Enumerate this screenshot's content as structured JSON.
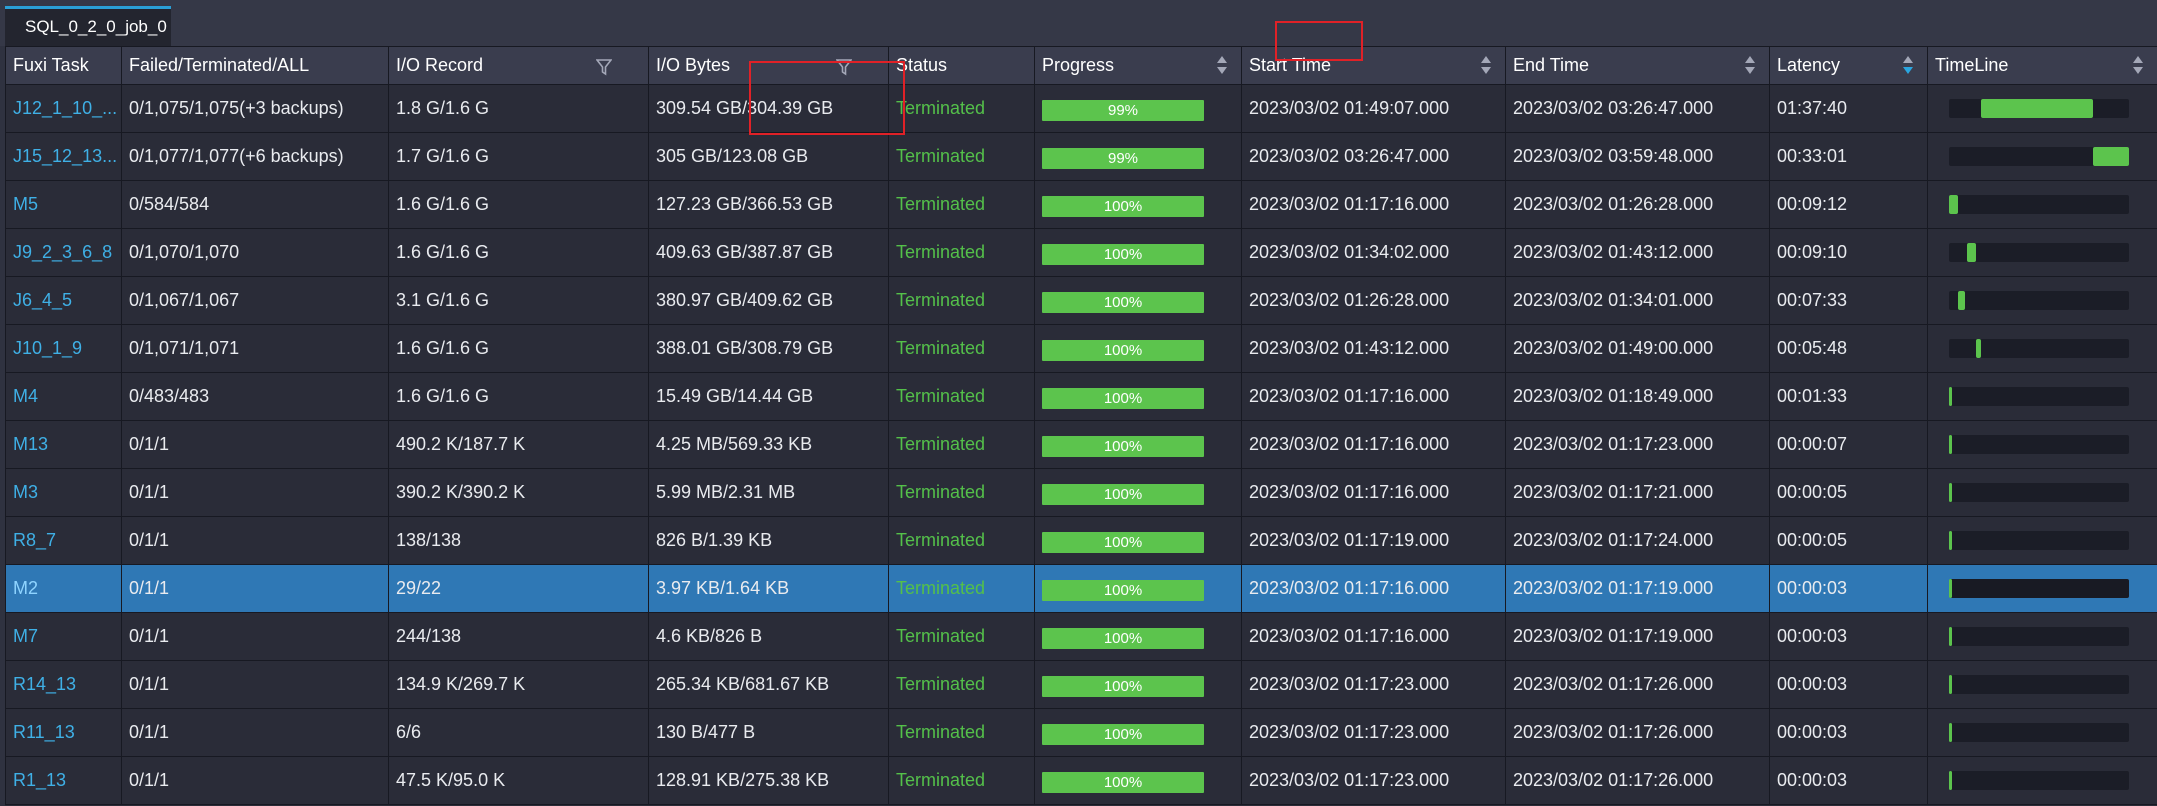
{
  "tab": {
    "label": "SQL_0_2_0_job_0"
  },
  "columns": {
    "task": "Fuxi Task",
    "instances": "Failed/Terminated/ALL",
    "io_record": "I/O Record",
    "io_bytes": "I/O Bytes",
    "status": "Status",
    "progress": "Progress",
    "start_time": "Start Time",
    "end_time": "End Time",
    "latency": "Latency",
    "timeline": "TimeLine"
  },
  "colors": {
    "accent": "#2a9fd6",
    "task_link": "#3fb0e6",
    "status_terminated": "#54c04a",
    "progress_fill": "#5cc44d",
    "selected_row": "#2f78b5",
    "highlight_box": "#e02127"
  },
  "icons": {
    "sort": "sort-icon",
    "filter": "filter-icon"
  },
  "selected_row_index": 10,
  "rows": [
    {
      "task": "J12_1_10_...",
      "instances": "0/1,075/1,075(+3 backups)",
      "io_record": "1.8 G/1.6 G",
      "io_bytes": "309.54 GB/304.39 GB",
      "status": "Terminated",
      "progress": "99%",
      "start_time": "2023/03/02 01:49:07.000",
      "end_time": "2023/03/02 03:26:47.000",
      "latency": "01:37:40",
      "timeline_start": 0.18,
      "timeline_end": 0.8
    },
    {
      "task": "J15_12_13...",
      "instances": "0/1,077/1,077(+6 backups)",
      "io_record": "1.7 G/1.6 G",
      "io_bytes": "305 GB/123.08 GB",
      "status": "Terminated",
      "progress": "99%",
      "start_time": "2023/03/02 03:26:47.000",
      "end_time": "2023/03/02 03:59:48.000",
      "latency": "00:33:01",
      "timeline_start": 0.8,
      "timeline_end": 1.0
    },
    {
      "task": "M5",
      "instances": "0/584/584",
      "io_record": "1.6 G/1.6 G",
      "io_bytes": "127.23 GB/366.53 GB",
      "status": "Terminated",
      "progress": "100%",
      "start_time": "2023/03/02 01:17:16.000",
      "end_time": "2023/03/02 01:26:28.000",
      "latency": "00:09:12",
      "timeline_start": 0.0,
      "timeline_end": 0.05
    },
    {
      "task": "J9_2_3_6_8",
      "instances": "0/1,070/1,070",
      "io_record": "1.6 G/1.6 G",
      "io_bytes": "409.63 GB/387.87 GB",
      "status": "Terminated",
      "progress": "100%",
      "start_time": "2023/03/02 01:34:02.000",
      "end_time": "2023/03/02 01:43:12.000",
      "latency": "00:09:10",
      "timeline_start": 0.1,
      "timeline_end": 0.15
    },
    {
      "task": "J6_4_5",
      "instances": "0/1,067/1,067",
      "io_record": "3.1 G/1.6 G",
      "io_bytes": "380.97 GB/409.62 GB",
      "status": "Terminated",
      "progress": "100%",
      "start_time": "2023/03/02 01:26:28.000",
      "end_time": "2023/03/02 01:34:01.000",
      "latency": "00:07:33",
      "timeline_start": 0.05,
      "timeline_end": 0.09
    },
    {
      "task": "J10_1_9",
      "instances": "0/1,071/1,071",
      "io_record": "1.6 G/1.6 G",
      "io_bytes": "388.01 GB/308.79 GB",
      "status": "Terminated",
      "progress": "100%",
      "start_time": "2023/03/02 01:43:12.000",
      "end_time": "2023/03/02 01:49:00.000",
      "latency": "00:05:48",
      "timeline_start": 0.15,
      "timeline_end": 0.18
    },
    {
      "task": "M4",
      "instances": "0/483/483",
      "io_record": "1.6 G/1.6 G",
      "io_bytes": "15.49 GB/14.44 GB",
      "status": "Terminated",
      "progress": "100%",
      "start_time": "2023/03/02 01:17:16.000",
      "end_time": "2023/03/02 01:18:49.000",
      "latency": "00:01:33",
      "timeline_start": 0.0,
      "timeline_end": 0.01
    },
    {
      "task": "M13",
      "instances": "0/1/1",
      "io_record": "490.2 K/187.7 K",
      "io_bytes": "4.25 MB/569.33 KB",
      "status": "Terminated",
      "progress": "100%",
      "start_time": "2023/03/02 01:17:16.000",
      "end_time": "2023/03/02 01:17:23.000",
      "latency": "00:00:07",
      "timeline_start": 0.0,
      "timeline_end": 0.005
    },
    {
      "task": "M3",
      "instances": "0/1/1",
      "io_record": "390.2 K/390.2 K",
      "io_bytes": "5.99 MB/2.31 MB",
      "status": "Terminated",
      "progress": "100%",
      "start_time": "2023/03/02 01:17:16.000",
      "end_time": "2023/03/02 01:17:21.000",
      "latency": "00:00:05",
      "timeline_start": 0.0,
      "timeline_end": 0.005
    },
    {
      "task": "R8_7",
      "instances": "0/1/1",
      "io_record": "138/138",
      "io_bytes": "826 B/1.39 KB",
      "status": "Terminated",
      "progress": "100%",
      "start_time": "2023/03/02 01:17:19.000",
      "end_time": "2023/03/02 01:17:24.000",
      "latency": "00:00:05",
      "timeline_start": 0.0,
      "timeline_end": 0.005
    },
    {
      "task": "M2",
      "instances": "0/1/1",
      "io_record": "29/22",
      "io_bytes": "3.97 KB/1.64 KB",
      "status": "Terminated",
      "progress": "100%",
      "start_time": "2023/03/02 01:17:16.000",
      "end_time": "2023/03/02 01:17:19.000",
      "latency": "00:00:03",
      "timeline_start": 0.0,
      "timeline_end": 0.005
    },
    {
      "task": "M7",
      "instances": "0/1/1",
      "io_record": "244/138",
      "io_bytes": "4.6 KB/826 B",
      "status": "Terminated",
      "progress": "100%",
      "start_time": "2023/03/02 01:17:16.000",
      "end_time": "2023/03/02 01:17:19.000",
      "latency": "00:00:03",
      "timeline_start": 0.0,
      "timeline_end": 0.005
    },
    {
      "task": "R14_13",
      "instances": "0/1/1",
      "io_record": "134.9 K/269.7 K",
      "io_bytes": "265.34 KB/681.67 KB",
      "status": "Terminated",
      "progress": "100%",
      "start_time": "2023/03/02 01:17:23.000",
      "end_time": "2023/03/02 01:17:26.000",
      "latency": "00:00:03",
      "timeline_start": 0.0,
      "timeline_end": 0.005
    },
    {
      "task": "R11_13",
      "instances": "0/1/1",
      "io_record": "6/6",
      "io_bytes": "130 B/477 B",
      "status": "Terminated",
      "progress": "100%",
      "start_time": "2023/03/02 01:17:23.000",
      "end_time": "2023/03/02 01:17:26.000",
      "latency": "00:00:03",
      "timeline_start": 0.0,
      "timeline_end": 0.005
    },
    {
      "task": "R1_13",
      "instances": "0/1/1",
      "io_record": "47.5 K/95.0 K",
      "io_bytes": "128.91 KB/275.38 KB",
      "status": "Terminated",
      "progress": "100%",
      "start_time": "2023/03/02 01:17:23.000",
      "end_time": "2023/03/02 01:17:26.000",
      "latency": "00:00:03",
      "timeline_start": 0.0,
      "timeline_end": 0.005
    }
  ]
}
